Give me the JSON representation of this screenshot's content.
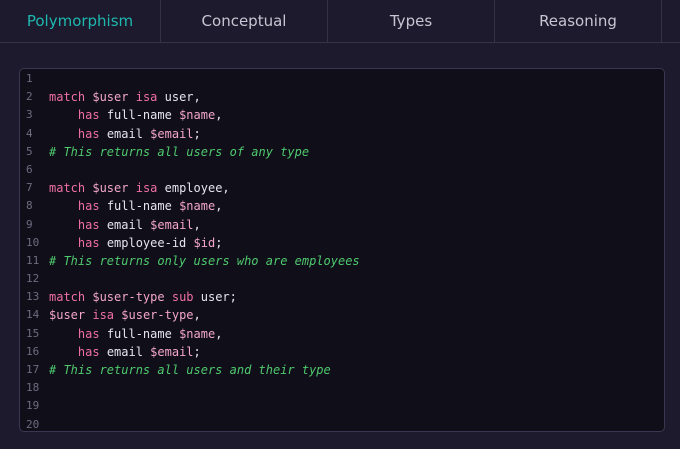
{
  "tabs": [
    {
      "label": "Polymorphism",
      "active": true
    },
    {
      "label": "Conceptual",
      "active": false
    },
    {
      "label": "Types",
      "active": false
    },
    {
      "label": "Reasoning",
      "active": false
    }
  ],
  "colors": {
    "active_tab": "#1fb8b0",
    "keyword": "#f06fa6",
    "variable": "#f3a6c8",
    "comment": "#4fc96d",
    "background": "#1c1a2c",
    "editor_background": "#0f0e19"
  },
  "code": {
    "lines": [
      {
        "n": "1",
        "tokens": []
      },
      {
        "n": "2",
        "tokens": [
          {
            "t": "kw",
            "v": "match "
          },
          {
            "t": "var",
            "v": "$user "
          },
          {
            "t": "kw",
            "v": "isa "
          },
          {
            "t": "id",
            "v": "user,"
          }
        ]
      },
      {
        "n": "3",
        "tokens": [
          {
            "t": "id",
            "v": "    "
          },
          {
            "t": "kw",
            "v": "has "
          },
          {
            "t": "id",
            "v": "full-name "
          },
          {
            "t": "var",
            "v": "$name"
          },
          {
            "t": "id",
            "v": ","
          }
        ]
      },
      {
        "n": "4",
        "tokens": [
          {
            "t": "id",
            "v": "    "
          },
          {
            "t": "kw",
            "v": "has "
          },
          {
            "t": "id",
            "v": "email "
          },
          {
            "t": "var",
            "v": "$email"
          },
          {
            "t": "id",
            "v": ";"
          }
        ]
      },
      {
        "n": "5",
        "tokens": [
          {
            "t": "cm",
            "v": "# This returns all users of any type"
          }
        ]
      },
      {
        "n": "6",
        "tokens": []
      },
      {
        "n": "7",
        "tokens": [
          {
            "t": "kw",
            "v": "match "
          },
          {
            "t": "var",
            "v": "$user "
          },
          {
            "t": "kw",
            "v": "isa "
          },
          {
            "t": "id",
            "v": "employee,"
          }
        ]
      },
      {
        "n": "8",
        "tokens": [
          {
            "t": "id",
            "v": "    "
          },
          {
            "t": "kw",
            "v": "has "
          },
          {
            "t": "id",
            "v": "full-name "
          },
          {
            "t": "var",
            "v": "$name"
          },
          {
            "t": "id",
            "v": ","
          }
        ]
      },
      {
        "n": "9",
        "tokens": [
          {
            "t": "id",
            "v": "    "
          },
          {
            "t": "kw",
            "v": "has "
          },
          {
            "t": "id",
            "v": "email "
          },
          {
            "t": "var",
            "v": "$email"
          },
          {
            "t": "id",
            "v": ","
          }
        ]
      },
      {
        "n": "10",
        "tokens": [
          {
            "t": "id",
            "v": "    "
          },
          {
            "t": "kw",
            "v": "has "
          },
          {
            "t": "id",
            "v": "employee-id "
          },
          {
            "t": "var",
            "v": "$id"
          },
          {
            "t": "id",
            "v": ";"
          }
        ]
      },
      {
        "n": "11",
        "tokens": [
          {
            "t": "cm",
            "v": "# This returns only users who are employees"
          }
        ]
      },
      {
        "n": "12",
        "tokens": []
      },
      {
        "n": "13",
        "tokens": [
          {
            "t": "kw",
            "v": "match "
          },
          {
            "t": "var",
            "v": "$user-type "
          },
          {
            "t": "kw",
            "v": "sub "
          },
          {
            "t": "id",
            "v": "user;"
          }
        ]
      },
      {
        "n": "14",
        "tokens": [
          {
            "t": "var",
            "v": "$user "
          },
          {
            "t": "kw",
            "v": "isa "
          },
          {
            "t": "var",
            "v": "$user-type"
          },
          {
            "t": "id",
            "v": ","
          }
        ]
      },
      {
        "n": "15",
        "tokens": [
          {
            "t": "id",
            "v": "    "
          },
          {
            "t": "kw",
            "v": "has "
          },
          {
            "t": "id",
            "v": "full-name "
          },
          {
            "t": "var",
            "v": "$name"
          },
          {
            "t": "id",
            "v": ","
          }
        ]
      },
      {
        "n": "16",
        "tokens": [
          {
            "t": "id",
            "v": "    "
          },
          {
            "t": "kw",
            "v": "has "
          },
          {
            "t": "id",
            "v": "email "
          },
          {
            "t": "var",
            "v": "$email"
          },
          {
            "t": "id",
            "v": ";"
          }
        ]
      },
      {
        "n": "17",
        "tokens": [
          {
            "t": "cm",
            "v": "# This returns all users and their type"
          }
        ]
      },
      {
        "n": "18",
        "tokens": []
      },
      {
        "n": "19",
        "tokens": []
      },
      {
        "n": "20",
        "tokens": []
      }
    ]
  }
}
